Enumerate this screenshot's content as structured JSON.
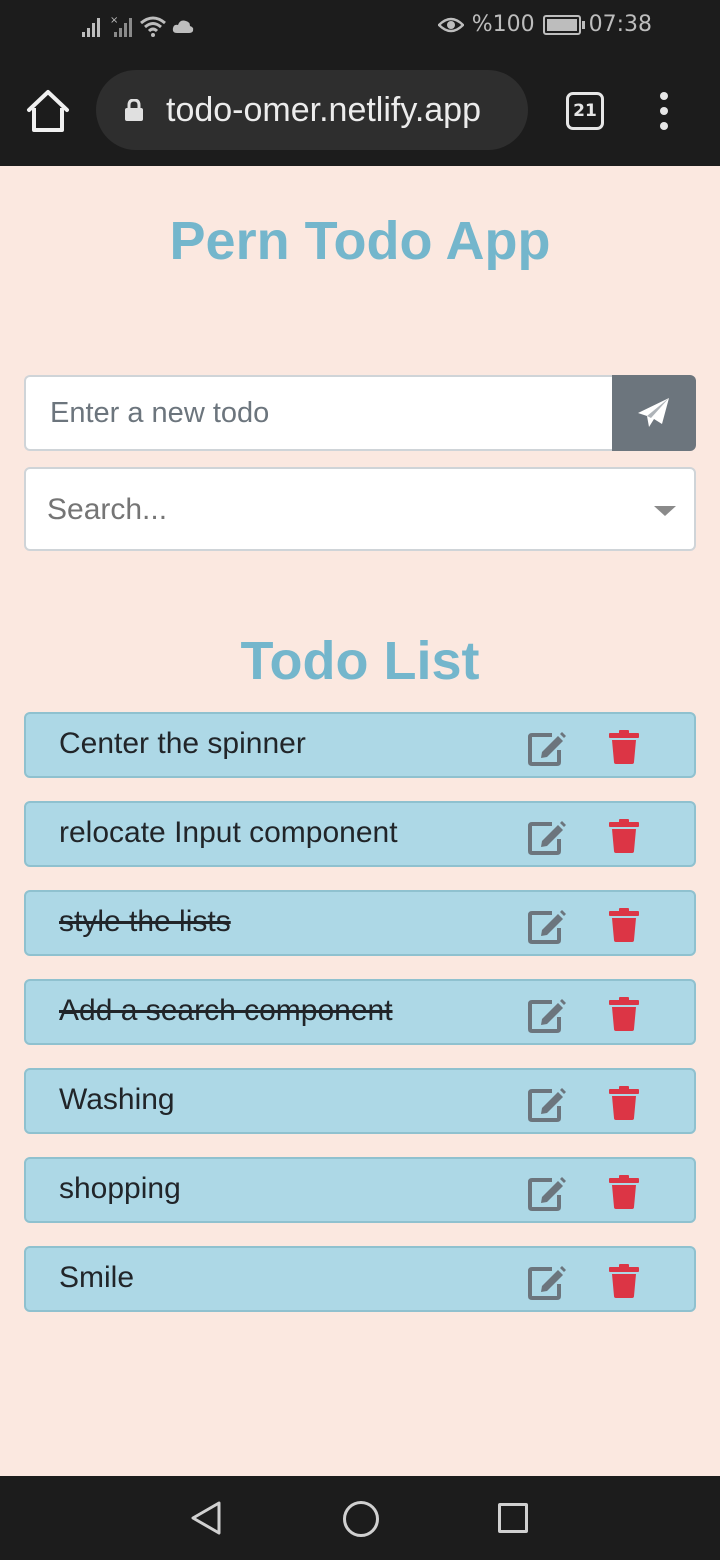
{
  "status_bar": {
    "battery": "%100",
    "time": "07:38"
  },
  "browser": {
    "url": "todo-omer.netlify.app",
    "tab_count": "21"
  },
  "app": {
    "title": "Pern Todo App",
    "todo_input_placeholder": "Enter a new todo",
    "search_placeholder": "Search...",
    "list_title": "Todo List"
  },
  "todos": [
    {
      "text": "Center the spinner",
      "completed": false
    },
    {
      "text": "relocate Input component",
      "completed": false
    },
    {
      "text": "style the lists",
      "completed": true
    },
    {
      "text": "Add a search component",
      "completed": true
    },
    {
      "text": "Washing",
      "completed": false
    },
    {
      "text": "shopping",
      "completed": false
    },
    {
      "text": "Smile",
      "completed": false
    }
  ],
  "colors": {
    "page_background": "#fbe8e0",
    "title": "#74b6cc",
    "todo_item_background": "#add8e6",
    "edit_icon": "#6c757d",
    "delete_icon": "#dc3545",
    "send_button": "#6c757d"
  },
  "icons": {
    "home": "home-icon",
    "lock": "lock-icon",
    "tabs": "tabs-icon",
    "menu": "more-vertical-icon",
    "send": "paper-plane-icon",
    "dropdown": "chevron-down-icon",
    "edit": "edit-icon",
    "delete": "trash-icon"
  }
}
